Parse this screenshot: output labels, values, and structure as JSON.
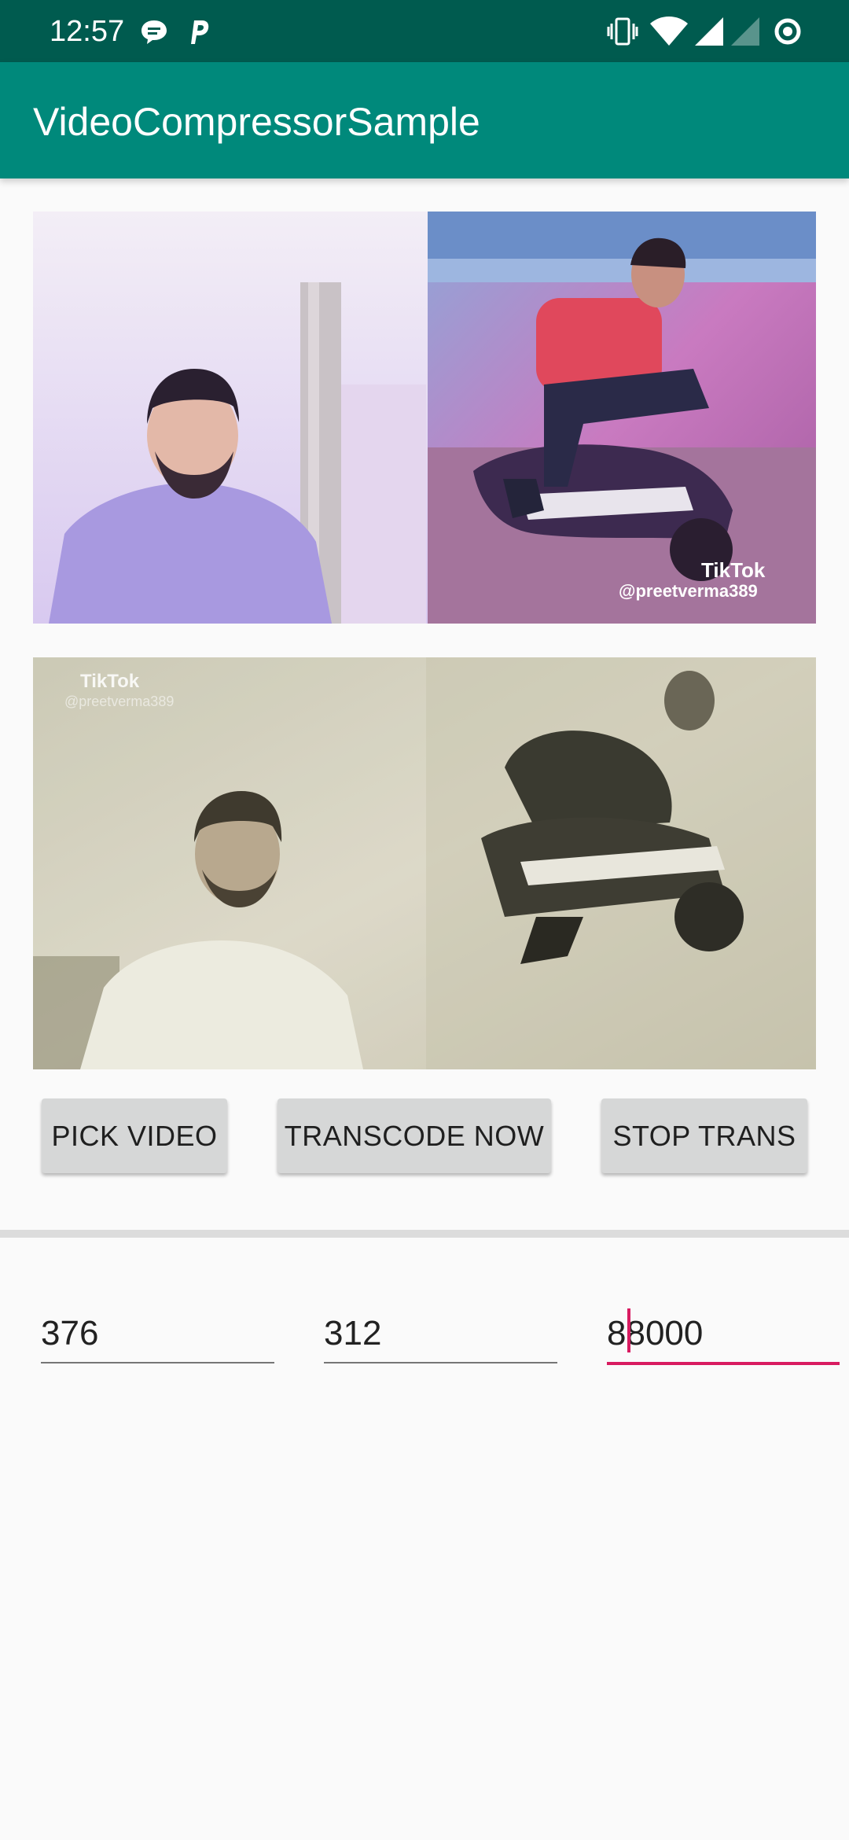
{
  "status_bar": {
    "time": "12:57",
    "left_icons": [
      "chat-bubble-icon",
      "p-letter-icon"
    ],
    "right_icons": [
      "vibrate-icon",
      "wifi-icon",
      "signal-full-icon",
      "signal-empty-icon",
      "circle-status-icon"
    ]
  },
  "app_bar": {
    "title": "VideoCompressorSample"
  },
  "frames": {
    "original": {
      "watermark_brand": "TikTok",
      "watermark_user": "@preetverma389"
    },
    "transcoded": {
      "watermark_brand": "TikTok",
      "watermark_user": "@preetverma389"
    }
  },
  "buttons": {
    "pick": "PICK VIDEO",
    "transcode": "TRANSCODE NOW",
    "stop": "STOP TRANS"
  },
  "fields": {
    "width_value": "376",
    "height_value": "312",
    "bitrate_value": "88000"
  },
  "colors": {
    "status_bar": "#005b4f",
    "app_bar": "#00897b",
    "accent": "#d81b60"
  }
}
